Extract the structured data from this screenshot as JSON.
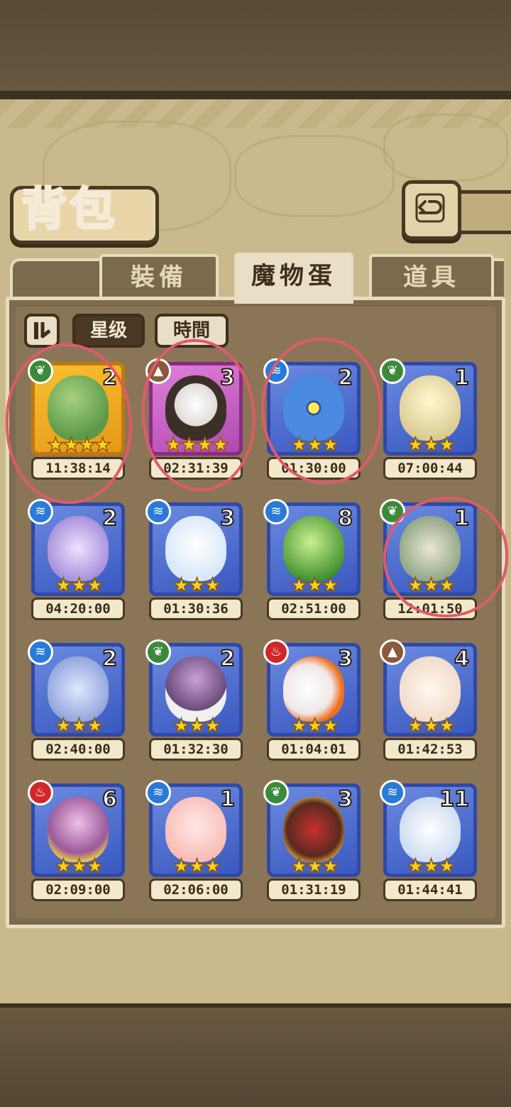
{
  "header": {
    "title": "背包"
  },
  "tabs": [
    {
      "label": "裝備"
    },
    {
      "label": "魔物蛋"
    },
    {
      "label": "道具"
    }
  ],
  "filters": {
    "star_label": "星级",
    "time_label": "時間"
  },
  "colors": {
    "annotation": "#e05a6a",
    "active_tab": "#e9dfc6",
    "panel": "#7e6b4e"
  },
  "eggs": [
    {
      "count": "2",
      "element": "leaf-icon",
      "stars": "★★★★",
      "timer": "11:38:14",
      "frame": "gold"
    },
    {
      "count": "3",
      "element": "rock-icon",
      "stars": "★★★★",
      "timer": "02:31:39",
      "frame": "purple"
    },
    {
      "count": "2",
      "element": "water-icon",
      "stars": "★★★",
      "timer": "01:30:00",
      "frame": "blue"
    },
    {
      "count": "1",
      "element": "leaf-icon",
      "stars": "★★★",
      "timer": "07:00:44",
      "frame": "blue"
    },
    {
      "count": "2",
      "element": "water-icon",
      "stars": "★★★",
      "timer": "04:20:00",
      "frame": "blue"
    },
    {
      "count": "3",
      "element": "water-icon",
      "stars": "★★★",
      "timer": "01:30:36",
      "frame": "blue"
    },
    {
      "count": "8",
      "element": "water-icon",
      "stars": "★★★",
      "timer": "02:51:00",
      "frame": "blue"
    },
    {
      "count": "1",
      "element": "leaf-icon",
      "stars": "★★★",
      "timer": "12:01:50",
      "frame": "blue"
    },
    {
      "count": "2",
      "element": "water-icon",
      "stars": "★★★",
      "timer": "02:40:00",
      "frame": "blue"
    },
    {
      "count": "2",
      "element": "leaf-icon",
      "stars": "★★★",
      "timer": "01:32:30",
      "frame": "blue"
    },
    {
      "count": "3",
      "element": "fire-icon",
      "stars": "★★★",
      "timer": "01:04:01",
      "frame": "blue"
    },
    {
      "count": "4",
      "element": "rock-icon",
      "stars": "★★★",
      "timer": "01:42:53",
      "frame": "blue"
    },
    {
      "count": "6",
      "element": "fire-icon",
      "stars": "★★★",
      "timer": "02:09:00",
      "frame": "blue"
    },
    {
      "count": "1",
      "element": "water-icon",
      "stars": "★★★",
      "timer": "02:06:00",
      "frame": "blue"
    },
    {
      "count": "3",
      "element": "leaf-icon",
      "stars": "★★★",
      "timer": "01:31:19",
      "frame": "blue"
    },
    {
      "count": "11",
      "element": "water-icon",
      "stars": "★★★",
      "timer": "01:44:41",
      "frame": "blue"
    }
  ]
}
